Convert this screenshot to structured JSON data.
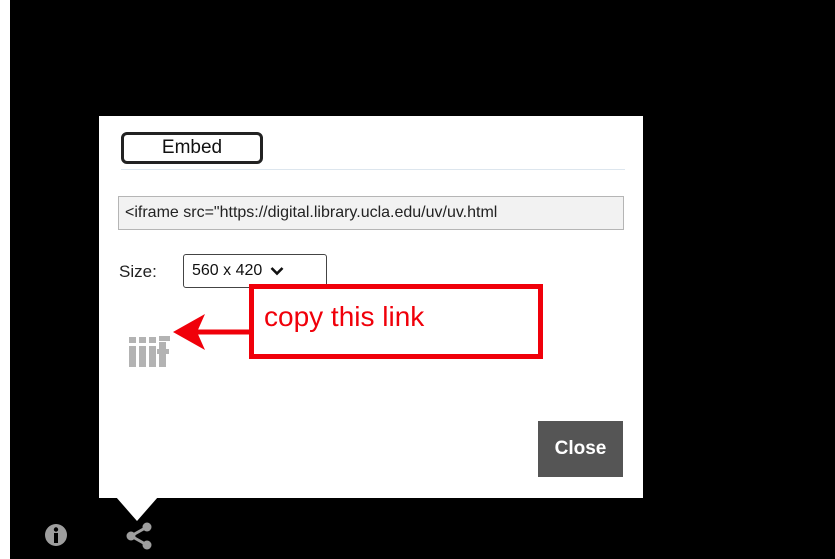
{
  "dialog": {
    "tab_label": "Embed",
    "embed_code": "<iframe src=\"https://digital.library.ucla.edu/uv/uv.html",
    "size_label": "Size:",
    "size_value": "560 x 420",
    "close_label": "Close"
  },
  "annotation": {
    "text": "copy this link"
  },
  "colors": {
    "annotation_red": "#f0000a",
    "close_button": "#555555",
    "background": "#000000"
  },
  "icons": {
    "info": "info-icon",
    "share": "share-icon",
    "iiif": "iiif-logo-icon"
  }
}
